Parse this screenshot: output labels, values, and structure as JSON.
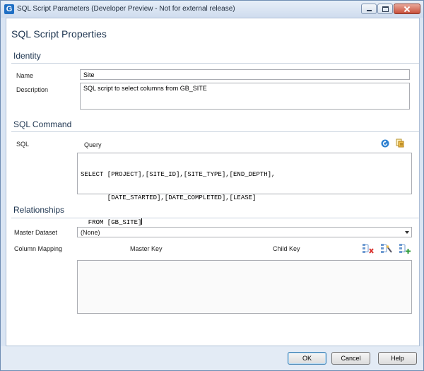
{
  "window": {
    "title": "SQL Script Parameters (Developer Preview - Not for external release)",
    "app_icon_letter": "G"
  },
  "page": {
    "title": "SQL Script Properties"
  },
  "identity": {
    "section_title": "Identity",
    "name_label": "Name",
    "name_value": "Site",
    "description_label": "Description",
    "description_value": "SQL script to select columns from GB_SITE"
  },
  "sql_command": {
    "section_title": "SQL Command",
    "sql_label": "SQL",
    "query_label": "Query",
    "query_lines": [
      "SELECT [PROJECT],[SITE_ID],[SITE_TYPE],[END_DEPTH],",
      "       [DATE_STARTED],[DATE_COMPLETED],[LEASE]",
      "  FROM [GB_SITE]"
    ]
  },
  "relationships": {
    "section_title": "Relationships",
    "master_dataset_label": "Master Dataset",
    "master_dataset_value": "(None)",
    "column_mapping_label": "Column Mapping",
    "master_key_label": "Master Key",
    "child_key_label": "Child Key"
  },
  "buttons": {
    "ok": "OK",
    "cancel": "Cancel",
    "help": "Help"
  },
  "icons": {
    "refresh": "refresh-icon",
    "query_builder": "query-builder-icon",
    "remove_mapping": "remove-mapping-icon",
    "auto_map": "auto-map-icon",
    "add_mapping": "add-mapping-icon"
  },
  "colors": {
    "accent": "#1f6fc4",
    "heading": "#1e3550",
    "window_frame": "#dae5f3"
  }
}
